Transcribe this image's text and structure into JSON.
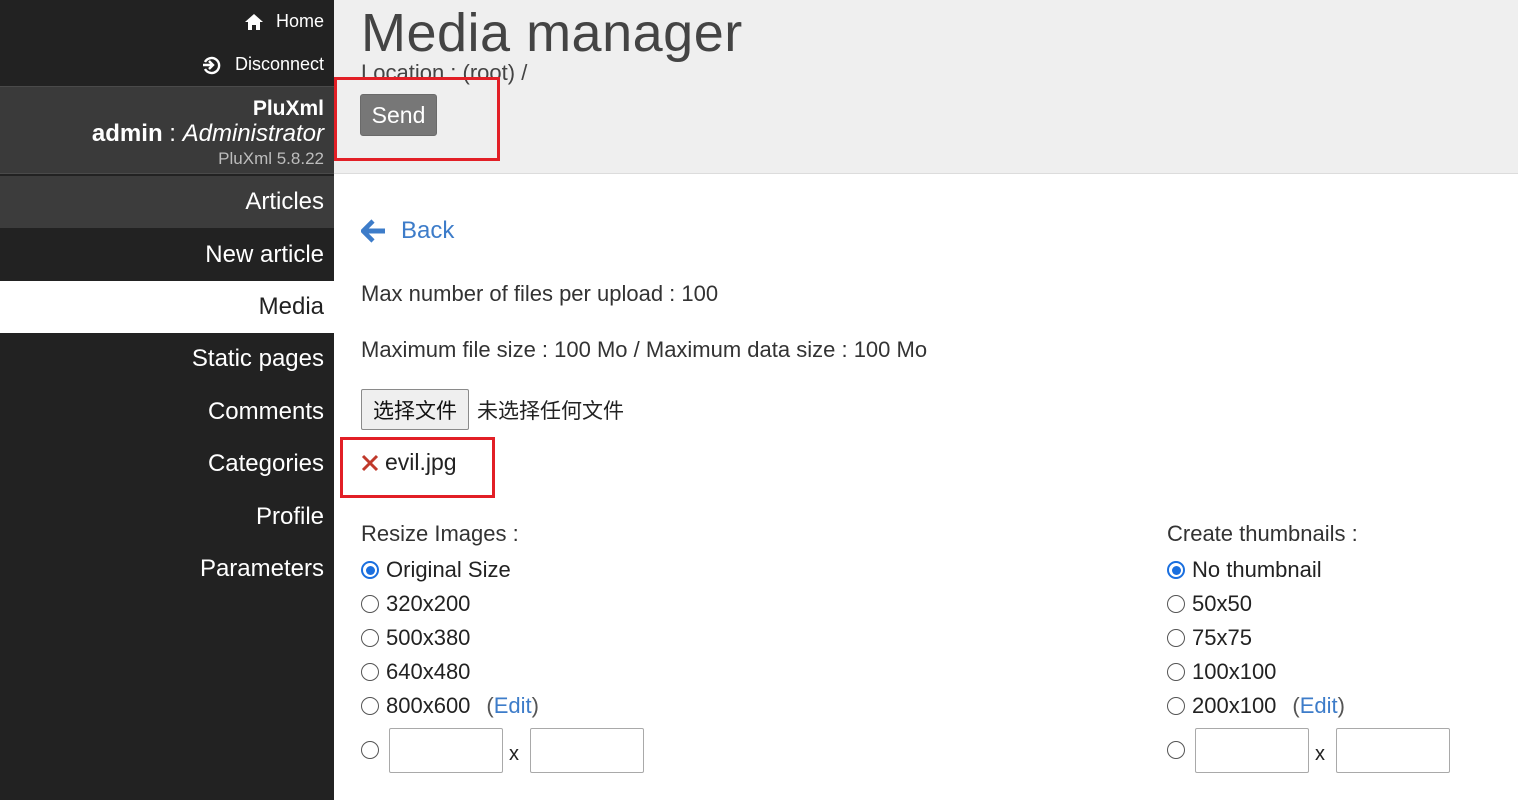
{
  "sidebar": {
    "top_links": [
      {
        "label": "Home",
        "icon": "home-icon"
      },
      {
        "label": "Disconnect",
        "icon": "sign-out-icon"
      }
    ],
    "site_name": "PluXml",
    "user_name": "admin",
    "user_separator": " : ",
    "user_role": "Administrator",
    "version": "PluXml 5.8.22",
    "menu": [
      {
        "label": "Articles"
      },
      {
        "label": "New article"
      },
      {
        "label": "Media"
      },
      {
        "label": "Static pages"
      },
      {
        "label": "Comments"
      },
      {
        "label": "Categories"
      },
      {
        "label": "Profile"
      },
      {
        "label": "Parameters"
      }
    ]
  },
  "header": {
    "title": "Media manager",
    "location": "Location : (root) /",
    "send_label": "Send"
  },
  "main": {
    "back_label": "Back",
    "max_files": "Max number of files per upload : 100",
    "max_size": "Maximum file size : 100 Mo / Maximum data size : 100 Mo",
    "file_button": "选择文件",
    "file_status": "未选择任何文件",
    "selected_file": "evil.jpg",
    "resize": {
      "title": "Resize Images :",
      "options": [
        "Original Size",
        "320x200",
        "500x380",
        "640x480",
        "800x600"
      ],
      "selected": "Original Size",
      "edit_label": "Edit",
      "times": "x"
    },
    "thumbs": {
      "title": "Create thumbnails :",
      "options": [
        "No thumbnail",
        "50x50",
        "75x75",
        "100x100",
        "200x100"
      ],
      "selected": "No thumbnail",
      "edit_label": "Edit",
      "times": "x"
    }
  },
  "colors": {
    "sidebar_bg": "#222222",
    "link": "#3d7cc9",
    "highlight": "#e21f26",
    "radio_on": "#1a6fdf"
  }
}
